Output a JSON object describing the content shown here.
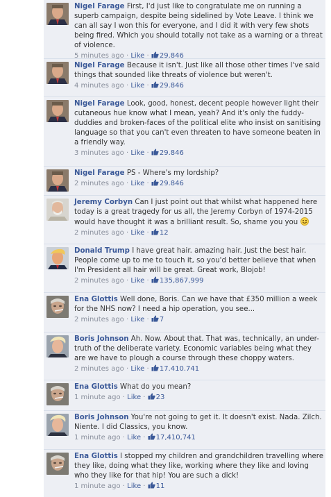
{
  "comments": [
    {
      "author": "Nigel Farage",
      "avatar": "nigel-farage",
      "text": "First, I'd just like to congratulate me on running a superb campaign, despite being sidelined by Vote Leave. I think we can all say I won this for everyone, and I did it with very few shots being fired. Which you should totally not take as a warning or a threat of violence.",
      "time": "5 minutes ago",
      "like_label": "Like",
      "likes": "29.846"
    },
    {
      "author": "Nigel Farage",
      "avatar": "nigel-farage",
      "text": "Because it isn't. Just like all those other times I've said things that sounded like threats of violence but weren't.",
      "time": "4 minutes ago",
      "like_label": "Like",
      "likes": "29.846"
    },
    {
      "author": "Nigel Farage",
      "avatar": "nigel-farage",
      "text": "Look, good, honest, decent people however light their cutaneous hue know what I mean, yeah? And it's only the fuddy-duddies and broken-faces of the political elite who insist on sanitising language so that you can't even threaten to have someone beaten in a friendly way.",
      "time": "3 minutes ago",
      "like_label": "Like",
      "likes": "29.846"
    },
    {
      "author": "Nigel Farage",
      "avatar": "nigel-farage",
      "text": "PS - Where's my lordship?",
      "time": "2 minutes ago",
      "like_label": "Like",
      "likes": "29.846"
    },
    {
      "author": "Jeremy Corbyn",
      "avatar": "jeremy-corbyn",
      "text": "Can I just point out that whilst what happened here today is a great tragedy for us all, the Jeremy Corbyn of 1974-2015 would have thought it was a brilliant result. So, shame you you",
      "emoji": "smile",
      "time": "2 minutes ago",
      "like_label": "Like",
      "likes": "12"
    },
    {
      "author": "Donald Trump",
      "avatar": "donald-trump",
      "text": "I have great hair. amazing hair. Just the best hair. People come up to me to touch it, so you'd better believe that when I'm President all hair will be great. Great work, Blojob!",
      "time": "2 minutes ago",
      "like_label": "Like",
      "likes": "135,867,999"
    },
    {
      "author": "Ena Glottis",
      "avatar": "ena-glottis",
      "text": "Well done, Boris. Can we have that £350 million a week for the NHS now? I need a hip operation, you see...",
      "time": "2 minutes ago",
      "like_label": "Like",
      "likes": "7"
    },
    {
      "author": "Boris Johnson",
      "avatar": "boris-johnson",
      "text": "Ah. Now. About that. That was, technically, an under-truth of the deliberate variety. Economic variables being what they are we have to plough a course through these choppy waters.",
      "time": "2 minutes ago",
      "like_label": "Like",
      "likes": "17.410.741"
    },
    {
      "author": "Ena Glottis",
      "avatar": "ena-glottis",
      "text": "What do you mean?",
      "time": "1 minute ago",
      "like_label": "Like",
      "likes": "23"
    },
    {
      "author": "Boris Johnson",
      "avatar": "boris-johnson",
      "text": "You're not going to get it. It doesn't exist. Nada. Zilch. Niente. I did Classics, you know.",
      "time": "1 minute ago",
      "like_label": "Like",
      "likes": "17,410,741"
    },
    {
      "author": "Ena Glottis",
      "avatar": "ena-glottis",
      "text": "I stopped my children and grandchildren travelling where they like, doing what they like, working where they like and loving who they like for that hip! You are such a dick!",
      "time": "1 minute ago",
      "like_label": "Like",
      "likes": "11"
    }
  ],
  "separator": "·",
  "colors": {
    "feed_background": "#edeff4",
    "divider": "#d8dfea",
    "link_blue": "#3b5998",
    "body_text": "#333333",
    "meta_grey": "#898f9c"
  }
}
